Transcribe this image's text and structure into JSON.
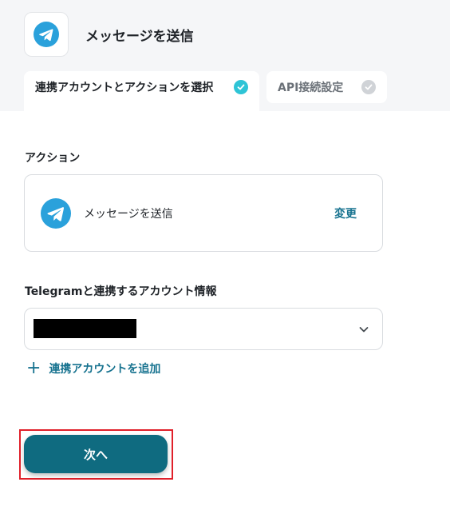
{
  "header": {
    "title": "メッセージを送信",
    "app_icon": "telegram-icon"
  },
  "tabs": [
    {
      "label": "連携アカウントとアクションを選択",
      "state": "complete"
    },
    {
      "label": "API接続設定",
      "state": "pending"
    }
  ],
  "action_section": {
    "label": "アクション",
    "action_name": "メッセージを送信",
    "change_label": "変更"
  },
  "account_section": {
    "label": "Telegramと連携するアカウント情報",
    "selected_value": "[redacted]",
    "add_account_label": "連携アカウントを追加"
  },
  "footer": {
    "next_label": "次へ"
  },
  "colors": {
    "accent": "#0f6b80",
    "link": "#16728f",
    "check_active": "#2ec4d6",
    "check_inactive": "#d0d3d7",
    "telegram": "#2aa1db",
    "highlight_border": "#e0202a"
  }
}
